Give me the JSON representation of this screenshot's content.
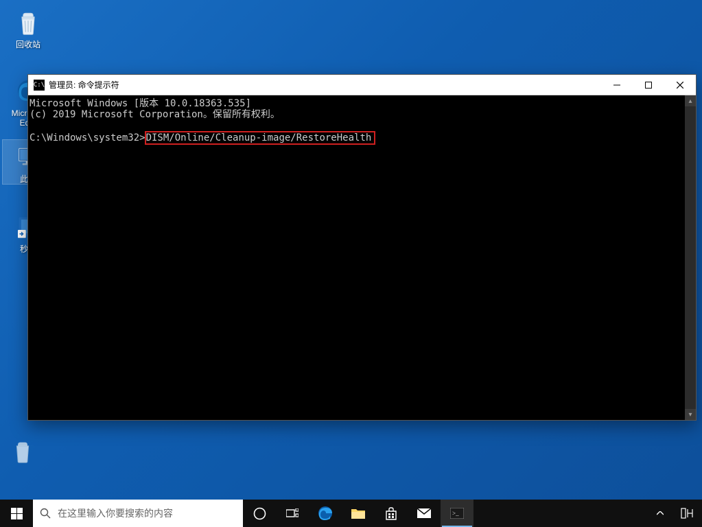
{
  "desktop": {
    "icons": [
      {
        "name": "recycle-bin",
        "label": "回收站"
      },
      {
        "name": "edge",
        "label": "Microsoft Ed..."
      },
      {
        "name": "this-pc",
        "label": "此电"
      },
      {
        "name": "shutdown-shortcut",
        "label": "秒关"
      }
    ]
  },
  "cmd": {
    "title": "管理员: 命令提示符",
    "line1": "Microsoft Windows [版本 10.0.18363.535]",
    "line2": "(c) 2019 Microsoft Corporation。保留所有权利。",
    "prompt": "C:\\Windows\\system32>",
    "command": "DISM/Online/Cleanup-image/RestoreHealth"
  },
  "taskbar": {
    "search_placeholder": "在这里输入你要搜索的内容"
  }
}
